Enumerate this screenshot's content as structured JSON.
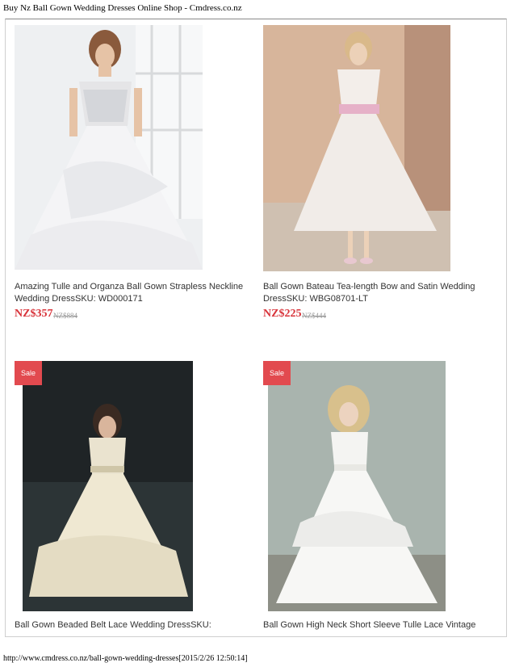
{
  "page": {
    "title": "Buy Nz Ball Gown Wedding Dresses Online Shop - Cmdress.co.nz",
    "footer_url": "http://www.cmdress.co.nz/ball-gown-wedding-dresses[2015/2/26 12:50:14]"
  },
  "products": [
    {
      "name_line1": "Amazing Tulle and Organza Ball Gown Strapless Neckline",
      "name_line2": "Wedding DressSKU: WD000171",
      "price": "NZ$357",
      "old_price": "NZ$884"
    },
    {
      "name_line1": "Ball Gown Bateau Tea-length Bow and Satin Wedding",
      "name_line2": "DressSKU: WBG08701-LT",
      "price": "NZ$225",
      "old_price": "NZ$444"
    },
    {
      "badge": "Sale",
      "name_line1": "Ball Gown Beaded Belt Lace Wedding DressSKU:"
    },
    {
      "badge": "Sale",
      "name_line1": "Ball Gown High Neck Short Sleeve Tulle Lace Vintage"
    }
  ]
}
